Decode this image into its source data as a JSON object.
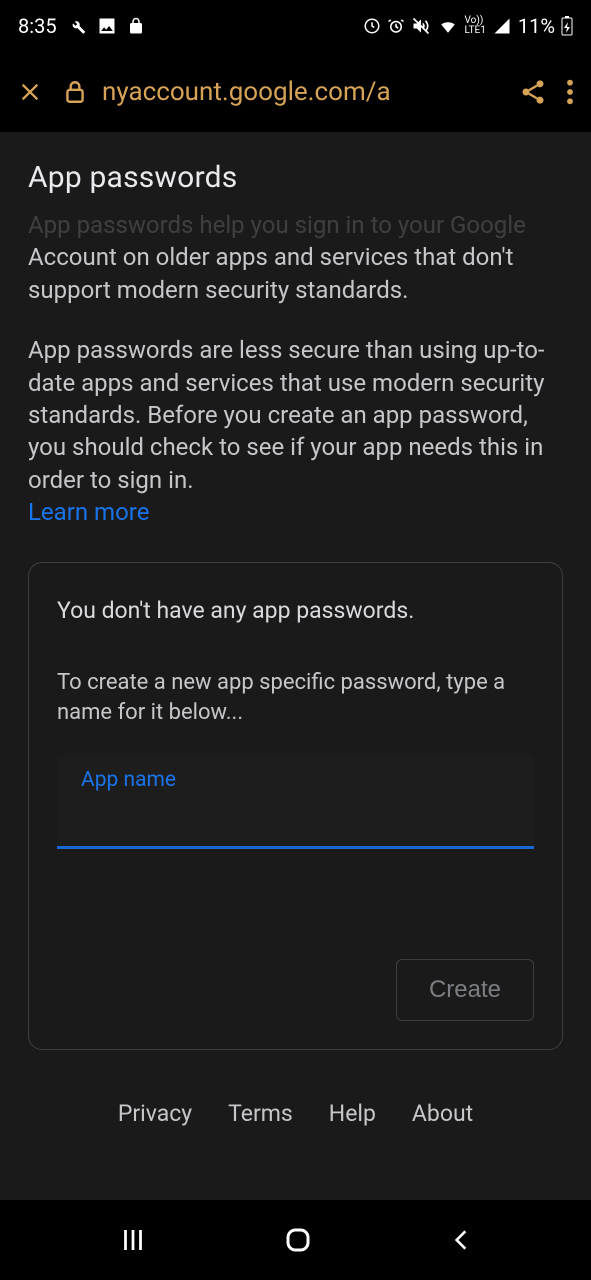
{
  "status": {
    "time": "8:35",
    "battery_percent": "11%"
  },
  "browser": {
    "url": "nyaccount.google.com/a"
  },
  "page": {
    "title": "App passwords",
    "desc_faded": "App passwords help you sign in to your Google",
    "desc_part1": "Account on older apps and services that don't support modern security standards.",
    "desc_part2": "App passwords are less secure than using up-to-date apps and services that use modern security standards. Before you create an app password, you should check to see if your app needs this in order to sign in.",
    "learn_more": "Learn more"
  },
  "card": {
    "empty_msg": "You don't have any app passwords.",
    "instruction": "To create a new app specific password, type a name for it below...",
    "input_label": "App name",
    "input_value": "",
    "create_label": "Create"
  },
  "footer": {
    "privacy": "Privacy",
    "terms": "Terms",
    "help": "Help",
    "about": "About"
  }
}
